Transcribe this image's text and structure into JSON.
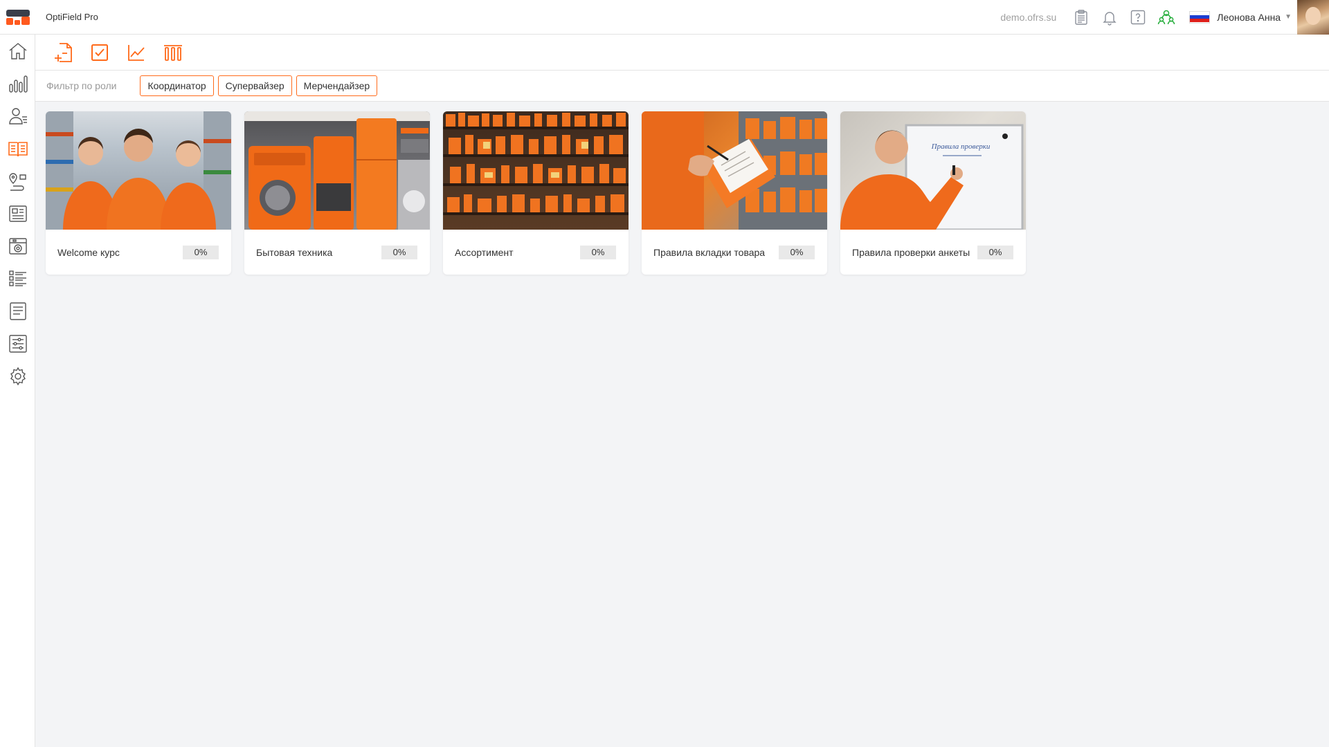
{
  "header": {
    "app_title": "OptiField Pro",
    "domain": "demo.ofrs.su",
    "user_name": "Леонова Анна",
    "icons": [
      "clipboard-icon",
      "bell-icon",
      "help-icon",
      "users-icon"
    ],
    "accent_color": "#ff6a1a",
    "green_color": "#27ae3d"
  },
  "sidebar": {
    "items": [
      {
        "icon": "home-icon"
      },
      {
        "icon": "bar-chart-icon"
      },
      {
        "icon": "user-list-icon"
      },
      {
        "icon": "book-icon",
        "active": true
      },
      {
        "icon": "map-route-icon"
      },
      {
        "icon": "news-icon"
      },
      {
        "icon": "photo-report-icon"
      },
      {
        "icon": "checklist-icon"
      },
      {
        "icon": "document-icon"
      },
      {
        "icon": "sliders-icon"
      },
      {
        "icon": "gear-icon"
      }
    ]
  },
  "toolbar": {
    "icons": [
      "add-document-icon",
      "checkbox-icon",
      "line-chart-icon",
      "ranking-icon"
    ]
  },
  "filter": {
    "label": "Фильтр по роли",
    "chips": [
      "Координатор",
      "Супервайзер",
      "Мерчендайзер"
    ]
  },
  "courses": [
    {
      "title": "Welcome курс",
      "progress": "0%"
    },
    {
      "title": "Бытовая техника",
      "progress": "0%"
    },
    {
      "title": "Ассортимент",
      "progress": "0%"
    },
    {
      "title": "Правила вкладки товара",
      "progress": "0%"
    },
    {
      "title": "Правила проверки анкеты",
      "progress": "0%",
      "image_text": "Правила проверки"
    }
  ]
}
